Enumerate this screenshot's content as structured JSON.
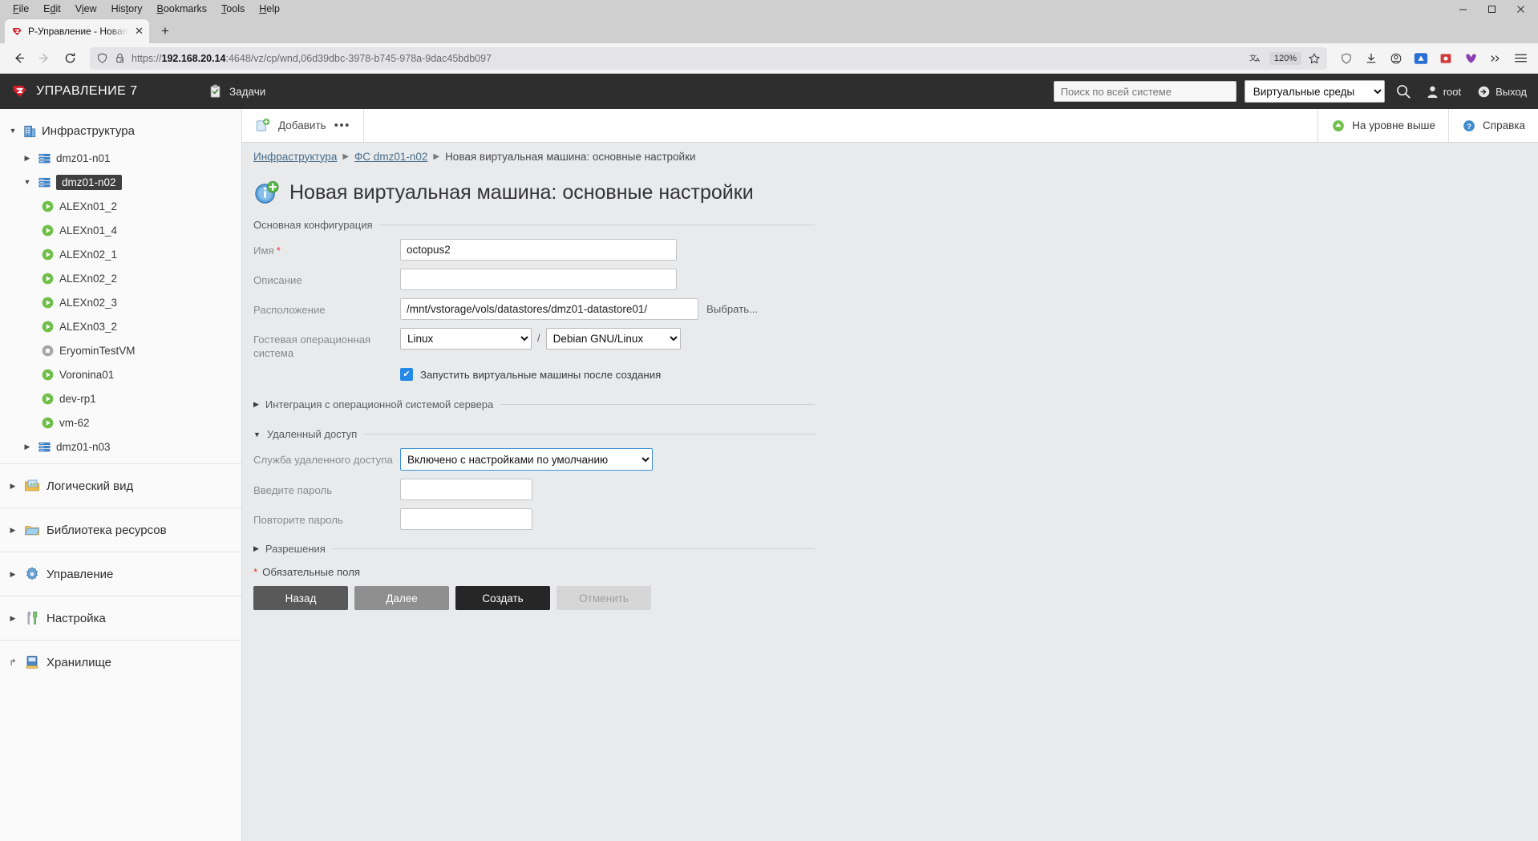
{
  "browser": {
    "menus": [
      "File",
      "Edit",
      "View",
      "History",
      "Bookmarks",
      "Tools",
      "Help"
    ],
    "window_controls": {
      "minimize": "—",
      "maximize": "□",
      "close": "✕"
    },
    "tab": {
      "title": "Р-Управление - Новая вирту",
      "close_label": "✕",
      "new_tab_label": "+"
    },
    "nav": {
      "back": "←",
      "forward": "→",
      "reload": "⟳"
    },
    "url": {
      "scheme": "https://",
      "host": "192.168.20.14",
      "rest": ":4648/vz/cp/wnd,06d39dbc-3978-b745-978a-9dac45bdb097",
      "zoom": "120%"
    }
  },
  "app_header": {
    "brand": "УПРАВЛЕНИЕ 7",
    "tasks": "Задачи",
    "search_placeholder": "Поиск по всей системе",
    "search_value": "",
    "env_select": "Виртуальные среды",
    "user": "root",
    "logout": "Выход"
  },
  "sidebar": {
    "root": {
      "label": "Инфраструктура",
      "icon": "building-icon",
      "expanded": true
    },
    "nodes": [
      {
        "label": "dmz01-n01",
        "icon": "server-icon",
        "expanded": false,
        "selected": false,
        "level": 1
      },
      {
        "label": "dmz01-n02",
        "icon": "server-icon",
        "expanded": true,
        "selected": true,
        "level": 1
      },
      {
        "label": "ALEXn01_2",
        "icon": "vm-running-icon",
        "level": 2
      },
      {
        "label": "ALEXn01_4",
        "icon": "vm-running-icon",
        "level": 2
      },
      {
        "label": "ALEXn02_1",
        "icon": "vm-running-icon",
        "level": 2
      },
      {
        "label": "ALEXn02_2",
        "icon": "vm-running-icon",
        "level": 2
      },
      {
        "label": "ALEXn02_3",
        "icon": "vm-running-icon",
        "level": 2
      },
      {
        "label": "ALEXn03_2",
        "icon": "vm-running-icon",
        "level": 2
      },
      {
        "label": "EryominTestVM",
        "icon": "vm-stopped-icon",
        "level": 2
      },
      {
        "label": "Voronina01",
        "icon": "vm-running-icon",
        "level": 2
      },
      {
        "label": "dev-rp1",
        "icon": "vm-running-icon",
        "level": 2
      },
      {
        "label": "vm-62",
        "icon": "vm-running-icon",
        "level": 2
      },
      {
        "label": "dmz01-n03",
        "icon": "server-icon",
        "expanded": false,
        "selected": false,
        "level": 1
      }
    ],
    "groups": [
      {
        "label": "Логический вид",
        "icon": "logical-view-icon",
        "twist": "▶"
      },
      {
        "label": "Библиотека ресурсов",
        "icon": "library-icon",
        "twist": "▶"
      },
      {
        "label": "Управление",
        "icon": "gear-icon",
        "twist": "▶"
      },
      {
        "label": "Настройка",
        "icon": "tools-icon",
        "twist": "▶"
      },
      {
        "label": "Хранилище",
        "icon": "storage-icon",
        "twist": "↱"
      }
    ]
  },
  "actionbar": {
    "add_label": "Добавить",
    "more_label": "•••",
    "level_up_label": "На уровне выше",
    "help_label": "Справка"
  },
  "breadcrumb": {
    "items": [
      "Инфраструктура",
      "ФС dmz01-n02",
      "Новая виртуальная машина: основные настройки"
    ],
    "separator": "▶"
  },
  "page": {
    "title": "Новая виртуальная машина: основные настройки",
    "sections": {
      "main_config": {
        "legend": "Основная конфигурация",
        "name_label": "Имя",
        "name_value": "octopus2",
        "name_required": "*",
        "desc_label": "Описание",
        "desc_value": "",
        "location_label": "Расположение",
        "location_value": "/mnt/vstorage/vols/datastores/dmz01-datastore01/",
        "choose_label": "Выбрать...",
        "guest_os_label": "Гостевая операционная система",
        "os_type": "Linux",
        "os_name": "Debian GNU/Linux",
        "separator": "/",
        "autostart_label": "Запустить виртуальные машины после создания",
        "autostart_checked": true
      },
      "integration": {
        "legend": "Интеграция с операционной системой сервера",
        "expanded": false,
        "caret": "▶"
      },
      "remote_access": {
        "legend": "Удаленный доступ",
        "expanded": true,
        "caret": "▼",
        "service_label": "Служба удаленного доступа",
        "service_value": "Включено с настройками по умолчанию",
        "password_label": "Введите пароль",
        "password_value": "",
        "password_repeat_label": "Повторите пароль",
        "password_repeat_value": ""
      },
      "permissions": {
        "legend": "Разрешения",
        "expanded": false,
        "caret": "▶"
      }
    },
    "required_note": "Обязательные поля",
    "required_star": "*",
    "buttons": {
      "back": "Назад",
      "next": "Далее",
      "create": "Создать",
      "cancel": "Отменить"
    }
  },
  "colors": {
    "header_bg": "#2e2e2e",
    "brand_red": "#d4202c",
    "accent_blue": "#2489e8",
    "vm_green": "#6fbf4a",
    "required_red": "#d33333",
    "link_blue": "#4a6e8a"
  }
}
